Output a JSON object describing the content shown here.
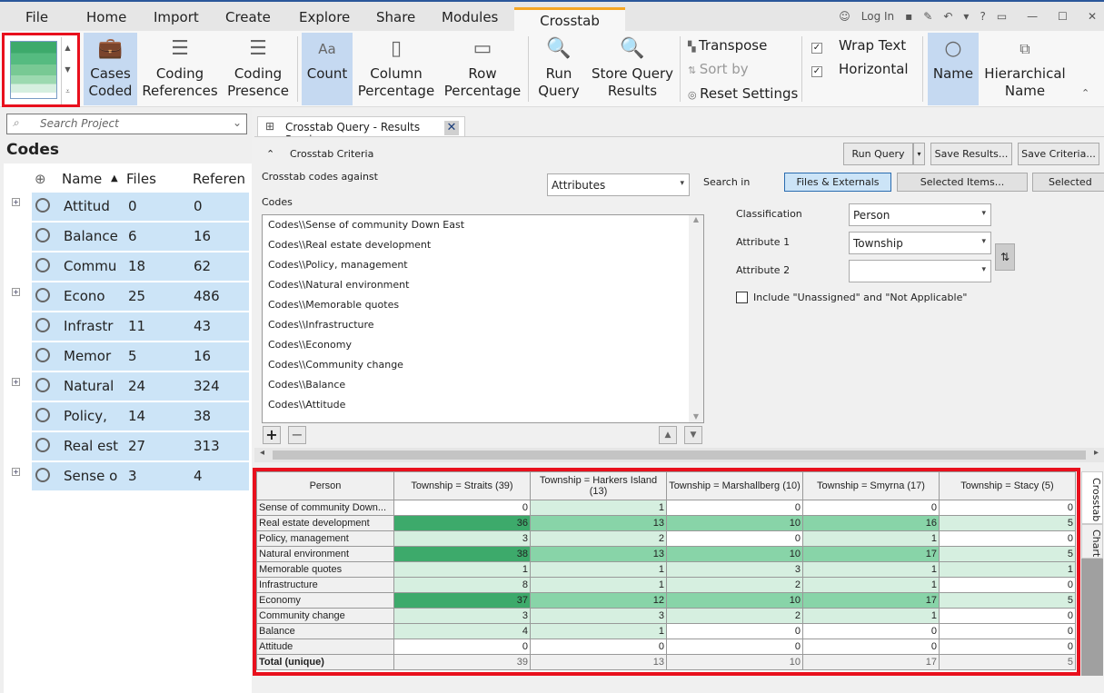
{
  "ribbon_tabs": [
    "File",
    "Home",
    "Import",
    "Create",
    "Explore",
    "Share",
    "Modules",
    "Crosstab"
  ],
  "window": {
    "login": "Log In",
    "help": "?"
  },
  "ribbon": {
    "cases_coded": "Cases Coded",
    "coding_references": "Coding References",
    "coding_presence": "Coding Presence",
    "count": "Count",
    "column_percentage": "Column Percentage",
    "row_percentage": "Row Percentage",
    "run_query": "Run Query",
    "store_query_results": "Store Query Results",
    "transpose": "Transpose",
    "sort_by": "Sort by",
    "reset_settings": "Reset Settings",
    "wrap_text": "Wrap Text",
    "horizontal": "Horizontal",
    "name": "Name",
    "hierarchical_name": "Hierarchical Name"
  },
  "left": {
    "search_placeholder": "Search Project",
    "title": "Codes",
    "columns": [
      "Name",
      "Files",
      "Referen"
    ],
    "items": [
      {
        "name": "Attitud",
        "files": "0",
        "refs": "0",
        "expandable": true
      },
      {
        "name": "Balance",
        "files": "6",
        "refs": "16",
        "expandable": false
      },
      {
        "name": "Commu",
        "files": "18",
        "refs": "62",
        "expandable": false
      },
      {
        "name": "Econo",
        "files": "25",
        "refs": "486",
        "expandable": true
      },
      {
        "name": "Infrastr",
        "files": "11",
        "refs": "43",
        "expandable": false
      },
      {
        "name": "Memor",
        "files": "5",
        "refs": "16",
        "expandable": false
      },
      {
        "name": "Natural",
        "files": "24",
        "refs": "324",
        "expandable": true
      },
      {
        "name": "Policy,",
        "files": "14",
        "refs": "38",
        "expandable": false
      },
      {
        "name": "Real est",
        "files": "27",
        "refs": "313",
        "expandable": false
      },
      {
        "name": "Sense o",
        "files": "3",
        "refs": "4",
        "expandable": true
      }
    ]
  },
  "doc_tab": {
    "title": "Crosstab Query - Results Preview",
    "close": "✕"
  },
  "criteria": {
    "header": "Crosstab Criteria",
    "against_label": "Crosstab codes against",
    "against_value": "Attributes",
    "codes_label": "Codes",
    "codes": [
      "Codes\\\\Sense of community Down East",
      "Codes\\\\Real estate development",
      "Codes\\\\Policy, management",
      "Codes\\\\Natural environment",
      "Codes\\\\Memorable quotes",
      "Codes\\\\Infrastructure",
      "Codes\\\\Economy",
      "Codes\\\\Community change",
      "Codes\\\\Balance",
      "Codes\\\\Attitude"
    ],
    "run_query": "Run Query",
    "save_results": "Save Results...",
    "save_criteria": "Save Criteria...",
    "search_in": "Search in",
    "files_externals": "Files & Externals",
    "selected_items": "Selected Items...",
    "selected_folders": "Selected Fo",
    "classification_label": "Classification",
    "classification": "Person",
    "attr1_label": "Attribute 1",
    "attr1": "Township",
    "attr2_label": "Attribute 2",
    "attr2": "",
    "include_label": "Include \"Unassigned\" and \"Not Applicable\"",
    "include_checked": false
  },
  "results": {
    "corner": "Person",
    "columns": [
      "Township = Straits (39)",
      "Township = Harkers Island (13)",
      "Township = Marshallberg (10)",
      "Township = Smyrna (17)",
      "Township = Stacy (5)"
    ],
    "rows": [
      {
        "label": "Sense of community Down...",
        "values": [
          0,
          1,
          0,
          0,
          0
        ]
      },
      {
        "label": "Real estate development",
        "values": [
          36,
          13,
          10,
          16,
          5
        ]
      },
      {
        "label": "Policy, management",
        "values": [
          3,
          2,
          0,
          1,
          0
        ]
      },
      {
        "label": "Natural environment",
        "values": [
          38,
          13,
          10,
          17,
          5
        ]
      },
      {
        "label": "Memorable quotes",
        "values": [
          1,
          1,
          3,
          1,
          1
        ]
      },
      {
        "label": "Infrastructure",
        "values": [
          8,
          1,
          2,
          1,
          0
        ]
      },
      {
        "label": "Economy",
        "values": [
          37,
          12,
          10,
          17,
          5
        ]
      },
      {
        "label": "Community change",
        "values": [
          3,
          3,
          2,
          1,
          0
        ]
      },
      {
        "label": "Balance",
        "values": [
          4,
          1,
          0,
          0,
          0
        ]
      },
      {
        "label": "Attitude",
        "values": [
          0,
          0,
          0,
          0,
          0
        ]
      }
    ],
    "total": {
      "label": "Total (unique)",
      "values": [
        39,
        13,
        10,
        17,
        5
      ]
    },
    "side_tabs": [
      "Crosstab",
      "Chart"
    ]
  },
  "colors": {
    "heat_high": "#3daa6b",
    "heat_mid": "#88d4a8",
    "heat_low": "#d6efe0",
    "selection": "#cce4f7",
    "highlight_border": "#e8101d",
    "active_tab": "#f5a623"
  }
}
